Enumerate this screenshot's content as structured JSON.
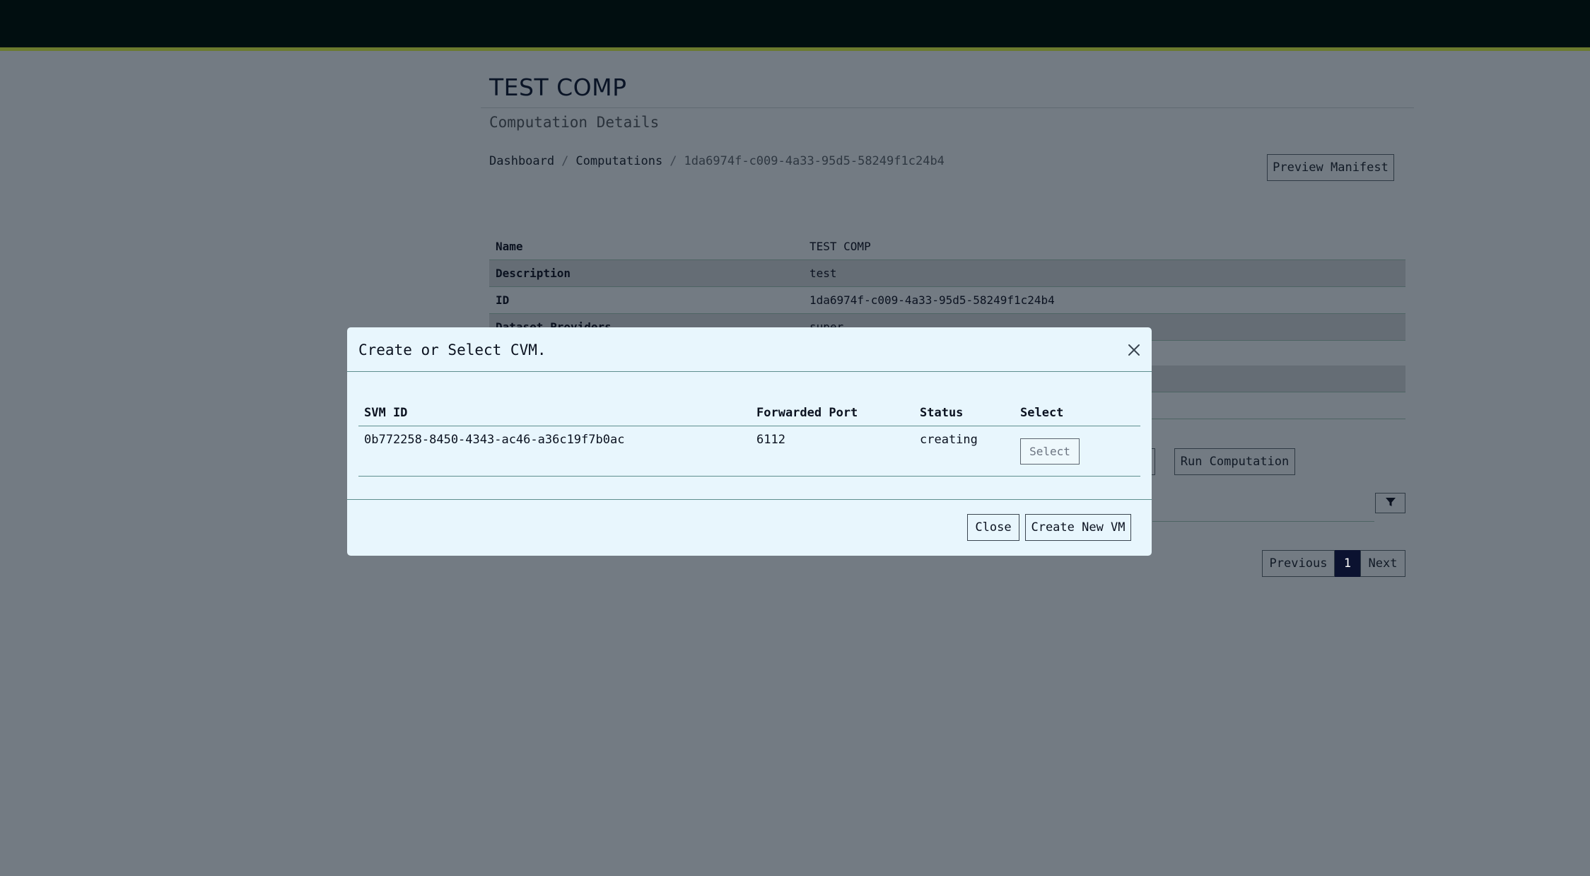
{
  "page": {
    "title": "TEST COMP",
    "subtitle": "Computation Details",
    "breadcrumb": {
      "items": [
        "Dashboard",
        "Computations"
      ],
      "separator": "/",
      "current": "1da6974f-c009-4a33-95d5-58249f1c24b4"
    },
    "preview_manifest_label": "Preview Manifest",
    "run_computation_label": "Run Computation"
  },
  "details": [
    {
      "label": "Name",
      "value": "TEST COMP"
    },
    {
      "label": "Description",
      "value": "test"
    },
    {
      "label": "ID",
      "value": "1da6974f-c009-4a33-95d5-58249f1c24b4"
    },
    {
      "label": "Dataset Providers",
      "value": "super"
    }
  ],
  "filter": {
    "icon": "filter-icon"
  },
  "pagination": {
    "previous": "Previous",
    "current_page": "1",
    "next": "Next"
  },
  "modal": {
    "title": "Create or Select CVM.",
    "close_icon": "close-icon",
    "columns": [
      "SVM ID",
      "Forwarded Port",
      "Status",
      "Select"
    ],
    "rows": [
      {
        "svm_id": "0b772258-8450-4343-ac46-a36c19f7b0ac",
        "port": "6112",
        "status": "creating",
        "action": "Select"
      }
    ],
    "close_label": "Close",
    "create_label": "Create New VM"
  },
  "colors": {
    "backdrop": "#737b83",
    "topbar": "#010e10",
    "topbar_accent": "#6b7a2e",
    "modal_bg": "#e8f6fd",
    "active_page": "#0b1230"
  }
}
